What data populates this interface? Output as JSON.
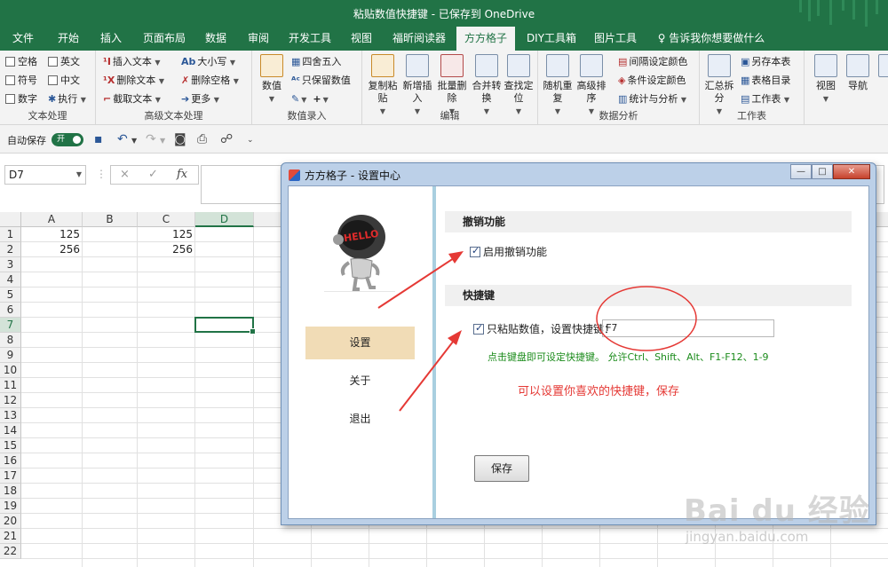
{
  "window": {
    "title": "粘贴数值快捷键 - 已保存到 OneDrive"
  },
  "tabs": [
    "文件",
    "开始",
    "插入",
    "页面布局",
    "数据",
    "审阅",
    "开发工具",
    "视图",
    "福昕阅读器",
    "方方格子",
    "DIY工具箱",
    "图片工具"
  ],
  "active_tab": "方方格子",
  "tell_me": "告诉我你想要做什么",
  "ribbon": {
    "text_group": {
      "items": [
        "空格",
        "英文",
        "符号",
        "中文",
        "数字",
        "执行"
      ],
      "label": "文本处理"
    },
    "adv_text_group": {
      "items": [
        "插入文本",
        "删除文本",
        "截取文本",
        "大小写",
        "删除空格",
        "更多"
      ],
      "label": "高级文本处理"
    },
    "numeric_group": {
      "items": [
        "数值",
        "四舍五入",
        "只保留数值"
      ],
      "label": "数值录入"
    },
    "edit_group": {
      "items": [
        "复制粘贴",
        "新增插入",
        "批量删除",
        "合并转换",
        "查找定位"
      ],
      "label": "编辑"
    },
    "analysis_group": {
      "items": [
        "随机重复",
        "高级排序",
        "间隔设定颜色",
        "条件设定颜色",
        "统计与分析"
      ],
      "label": "数据分析"
    },
    "worksheet_group": {
      "items": [
        "汇总拆分",
        "另存本表",
        "表格目录",
        "工作表"
      ],
      "label": "工作表"
    },
    "view_group": {
      "items": [
        "视图",
        "导航"
      ]
    }
  },
  "qat": {
    "autosave_label": "自动保存",
    "toggle_label": "开"
  },
  "formula_bar": {
    "name_box": "D7",
    "cancel": "×",
    "enter": "✓",
    "fx": "fx",
    "formula": ""
  },
  "sheet": {
    "columns": [
      "A",
      "B",
      "C",
      "D"
    ],
    "rows": [
      "1",
      "2",
      "3",
      "4",
      "5",
      "6",
      "7",
      "8",
      "9",
      "10",
      "11",
      "12",
      "13",
      "14",
      "15",
      "16",
      "17",
      "18",
      "19",
      "20",
      "21",
      "22"
    ],
    "selected_cell": "D7",
    "cells": {
      "A1": "125",
      "C1": "125",
      "A2": "256",
      "C2": "256"
    }
  },
  "dialog": {
    "title": "方方格子 - 设置中心",
    "nav": [
      "设置",
      "关于",
      "退出"
    ],
    "active_nav": "设置",
    "undo_section": "撤销功能",
    "undo_checkbox": "启用撤销功能",
    "hotkey_section": "快捷键",
    "hotkey_checkbox": "只粘贴数值，设置快捷键：",
    "hotkey_value": "F7",
    "hint": "点击键盘即可设定快捷键。  允许Ctrl、Shift、Alt、F1-F12、1-9",
    "save_button": "保存",
    "robot_badge": "HELLO"
  },
  "annotation": "可以设置你喜欢的快捷键，保存",
  "watermark": {
    "main": "Bai du 经验",
    "sub": "jingyan.baidu.com"
  },
  "colors": {
    "excel_green": "#217346",
    "annotation_red": "#e53935",
    "hint_green": "#1c8c1c",
    "nav_active": "#f1dcb6"
  }
}
